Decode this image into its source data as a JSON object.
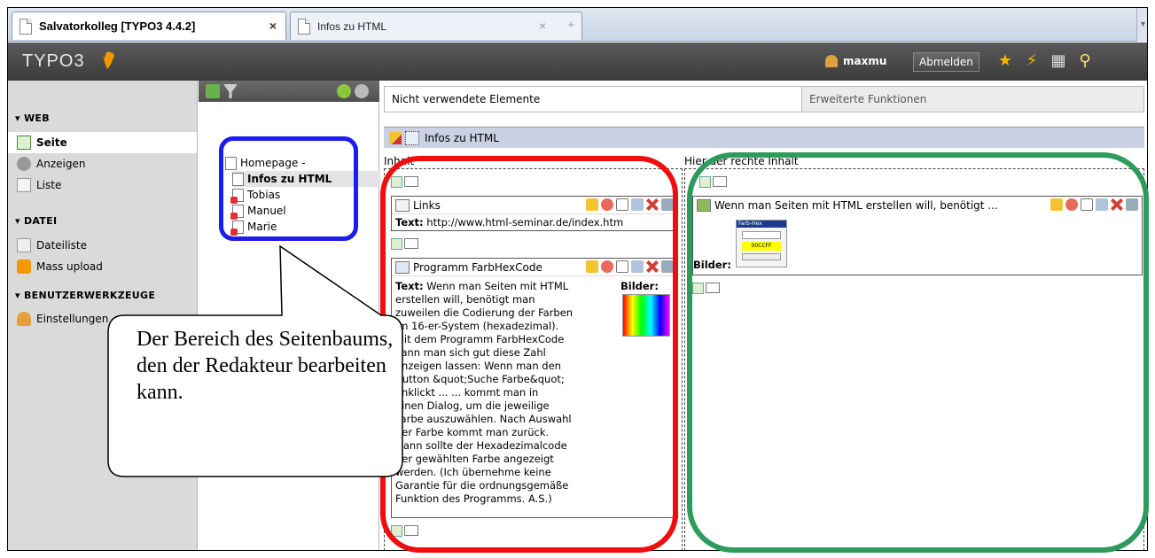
{
  "browser": {
    "tabs": [
      {
        "label": "Salvatorkolleg [TYPO3 4.4.2]",
        "close": "×"
      },
      {
        "label": "Infos zu HTML",
        "close": "×",
        "new": "+"
      }
    ]
  },
  "header": {
    "logo": "TYPO3",
    "user": "maxmu",
    "logout": "Abmelden",
    "icons": [
      "star-icon",
      "bolt-icon",
      "documents-icon",
      "search-icon"
    ]
  },
  "module_menu": {
    "groups": [
      {
        "label": "▾ WEB",
        "items": [
          {
            "label": "Seite",
            "active": true,
            "icon": "page-icon"
          },
          {
            "label": "Anzeigen",
            "icon": "eye-icon"
          },
          {
            "label": "Liste",
            "icon": "list-icon"
          }
        ]
      },
      {
        "label": "▾ DATEI",
        "items": [
          {
            "label": "Dateiliste",
            "icon": "folder-icon"
          },
          {
            "label": "Mass upload",
            "icon": "upload-icon"
          }
        ]
      },
      {
        "label": "▾ BENUTZERWERKZEUGE",
        "items": [
          {
            "label": "Einstellungen",
            "icon": "user-settings-icon"
          }
        ]
      }
    ]
  },
  "page_tree": {
    "root": "Homepage -",
    "pages": [
      "Infos zu HTML",
      "Tobias",
      "Manuel",
      "Marie"
    ]
  },
  "main": {
    "tabs": [
      "Nicht verwendete Elemente",
      "Erweiterte Funktionen"
    ],
    "page_title": "Infos zu HTML",
    "col_left_label": "Inhalt",
    "col_right_label": "Hier der rechte Inhalt",
    "elements": {
      "links": {
        "title": "Links",
        "text_label": "Text:",
        "text": "http://www.html-seminar.de/index.htm"
      },
      "farbhex": {
        "title": "Programm FarbHexCode",
        "text_label": "Text:",
        "images_label": "Bilder:",
        "lines": [
          "Wenn man Seiten mit HTML",
          "erstellen will, benötigt man",
          "zuweilen die Codierung der Farben",
          "im 16-er-System (hexadezimal).",
          "Mit dem Programm FarbHexCode",
          "kann man sich gut diese Zahl",
          "anzeigen lassen: Wenn man den",
          "Button &quot;Suche Farbe&quot;",
          "anklickt ... ... kommt man in",
          "einen Dialog, um die jeweilige",
          "Farbe auszuwählen. Nach Auswahl",
          "der Farbe kommt man zurück.",
          "Dann sollte der Hexadezimalcode",
          "der gewählten Farbe angezeigt",
          "werden. (Ich übernehme keine",
          "Garantie für die ordnungsgemäße",
          "Funktion des Programms. A.S.)"
        ]
      },
      "right": {
        "title": "Wenn man Seiten mit HTML erstellen will, benötigt ...",
        "images_label": "Bilder:",
        "thumb_caption": "Farb-Hex",
        "thumb_value": "00CCFF"
      }
    }
  },
  "annotation": {
    "callout": "Der Bereich des Seitenbaums, den der Redakteur bearbeiten kann.",
    "colors": {
      "blue": "#1c1cf0",
      "red": "#ef0e0e",
      "green": "#2e9a5c"
    }
  }
}
